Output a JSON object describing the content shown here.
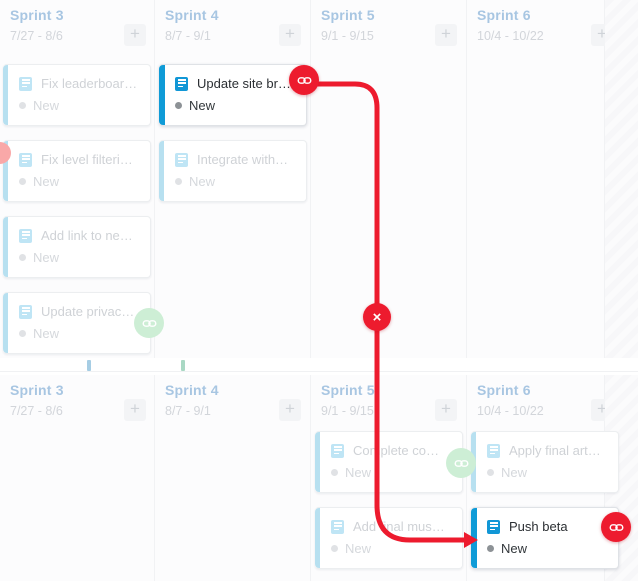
{
  "app": {
    "view_name": "sprint-board",
    "colors": {
      "accent_blue": "#0f9bd7",
      "card_accent_light": "#b7e0f0",
      "column_title": "#a8c6e2",
      "link_red": "#ed1b2e",
      "link_green": "#cdeed5",
      "tick_blue": "#a6cde4",
      "tick_green": "#a9d8c4",
      "marker_pink": "#f9a8a8"
    }
  },
  "boards": [
    {
      "name": "upper-board",
      "columns": [
        {
          "title": "Sprint 3",
          "dates": "7/27 - 8/6",
          "add_label": "+",
          "cards": [
            {
              "title": "Fix leaderboar…",
              "status": "New",
              "active": false,
              "badge": null
            },
            {
              "title": "Fix level filteri…",
              "status": "New",
              "active": false,
              "badge": null
            },
            {
              "title": "Add link to ne…",
              "status": "New",
              "active": false,
              "badge": null
            },
            {
              "title": "Update privac…",
              "status": "New",
              "active": false,
              "badge": "link-green"
            }
          ]
        },
        {
          "title": "Sprint 4",
          "dates": "8/7 - 9/1",
          "add_label": "+",
          "cards": [
            {
              "title": "Update site br…",
              "status": "New",
              "active": true,
              "badge": "link-red"
            },
            {
              "title": "Integrate with…",
              "status": "New",
              "active": false,
              "badge": null
            }
          ]
        },
        {
          "title": "Sprint 5",
          "dates": "9/1 - 9/15",
          "add_label": "+",
          "cards": []
        },
        {
          "title": "Sprint 6",
          "dates": "10/4 - 10/22",
          "add_label": "+",
          "cards": []
        }
      ]
    },
    {
      "name": "lower-board",
      "columns": [
        {
          "title": "Sprint 3",
          "dates": "7/27 - 8/6",
          "add_label": "+",
          "cards": []
        },
        {
          "title": "Sprint 4",
          "dates": "8/7 - 9/1",
          "add_label": "+",
          "cards": []
        },
        {
          "title": "Sprint 5",
          "dates": "9/1 - 9/15",
          "add_label": "+",
          "cards": [
            {
              "title": "Complete co…",
              "status": "New",
              "active": false,
              "badge": "link-green"
            },
            {
              "title": "Add final mus…",
              "status": "New",
              "active": false,
              "badge": null
            }
          ]
        },
        {
          "title": "Sprint 6",
          "dates": "10/4 - 10/22",
          "add_label": "+",
          "cards": [
            {
              "title": "Apply final art…",
              "status": "New",
              "active": false,
              "badge": null
            },
            {
              "title": "Push beta",
              "status": "New",
              "active": true,
              "badge": "link-red"
            }
          ]
        }
      ]
    }
  ],
  "connector": {
    "name": "dependency-link",
    "color": "#ed1b2e",
    "from_card": "Update site br…",
    "to_card": "Push beta",
    "remove_marker": "×"
  }
}
